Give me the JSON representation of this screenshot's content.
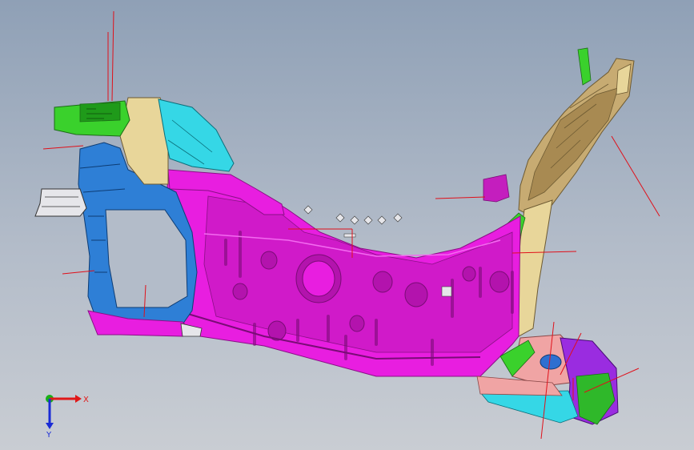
{
  "viewport": {
    "background_top": "#8fa0b6",
    "background_bottom": "#c9cdd3"
  },
  "model": {
    "part_colors": {
      "main_panel": "#e81ee0",
      "main_panel_dark": "#b313ad",
      "blue_frame": "#2e7fd6",
      "cyan_bracket": "#35d7e6",
      "green_bracket": "#3ad12c",
      "beige_member": "#e8d69a",
      "tan_tower": "#c7ab72",
      "white_bracket": "#e6e6ea",
      "salmon_plate": "#f0a4a4",
      "purple_bracket": "#9a2ce0",
      "leader_line": "#e0101a"
    }
  },
  "triad": {
    "x_label": "X",
    "y_label": "Y",
    "x_color": "#e01818",
    "y_color": "#1a2bd6",
    "z_color": "#18b018"
  }
}
